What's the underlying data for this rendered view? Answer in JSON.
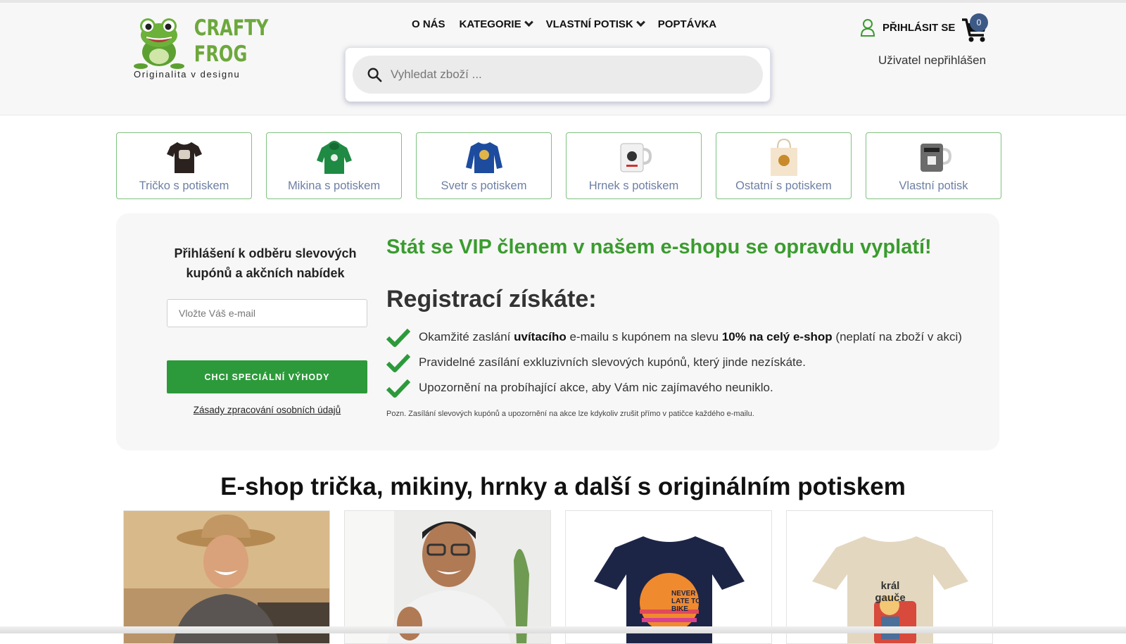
{
  "brand": {
    "name_line1": "CRAFTY",
    "name_line2": "FROG",
    "tagline": "Originalita v designu",
    "green": "#6da83c"
  },
  "nav": {
    "items": [
      {
        "label": "O NÁS",
        "has_dropdown": false
      },
      {
        "label": "KATEGORIE",
        "has_dropdown": true
      },
      {
        "label": "VLASTNÍ POTISK",
        "has_dropdown": true
      },
      {
        "label": "POPTÁVKA",
        "has_dropdown": false
      }
    ]
  },
  "search": {
    "placeholder": "Vyhledat zboží ..."
  },
  "account": {
    "login_label": "PŘIHLÁSIT SE",
    "status": "Uživatel nepřihlášen",
    "cart_count": "0"
  },
  "categories": [
    {
      "label": "Tričko s potiskem",
      "icon": "tshirt-icon"
    },
    {
      "label": "Mikina s potiskem",
      "icon": "hoodie-icon"
    },
    {
      "label": "Svetr s potiskem",
      "icon": "sweater-icon"
    },
    {
      "label": "Hrnek s potiskem",
      "icon": "mug-icon"
    },
    {
      "label": "Ostatní s potiskem",
      "icon": "tote-bag-icon"
    },
    {
      "label": "Vlastní potisk",
      "icon": "custom-mug-icon"
    }
  ],
  "promo": {
    "newsletter_title": "Přihlášení k odběru slevových kupónů a akčních nabídek",
    "email_placeholder": "Vložte Váš e-mail",
    "cta_label": "CHCI SPECIÁLNÍ VÝHODY",
    "privacy_link": "Zásady zpracování osobních údajů",
    "vip_title": "Stát se VIP členem v našem e-shopu se opravdu vyplatí!",
    "reg_title": "Registrací získáte:",
    "benefit1_a": "Okamžité zaslání ",
    "benefit1_b": "uvítacího",
    "benefit1_c": " e-mailu s kupónem na slevu ",
    "benefit1_d": "10% na celý e-shop",
    "benefit1_e": " (neplatí na zboží v akci)",
    "benefit2": "Pravidelné zasílání exkluzivních slevových kupónů, který jinde nezískáte.",
    "benefit3": "Upozornění na probíhající akce, aby Vám nic zajímavého neuniklo.",
    "note": "Pozn. Zasílání slevových kupónů a upozornění na akce lze kdykoliv zrušit přímo v patičce každého e-mailu.",
    "accent": "#2c9a3a"
  },
  "section": {
    "title": "E-shop trička, mikiny, hrnky a další s originálním potiskem"
  },
  "products": {
    "p3_print": "NEVER LATE TO BIKE",
    "p4_print": "král gauče"
  }
}
